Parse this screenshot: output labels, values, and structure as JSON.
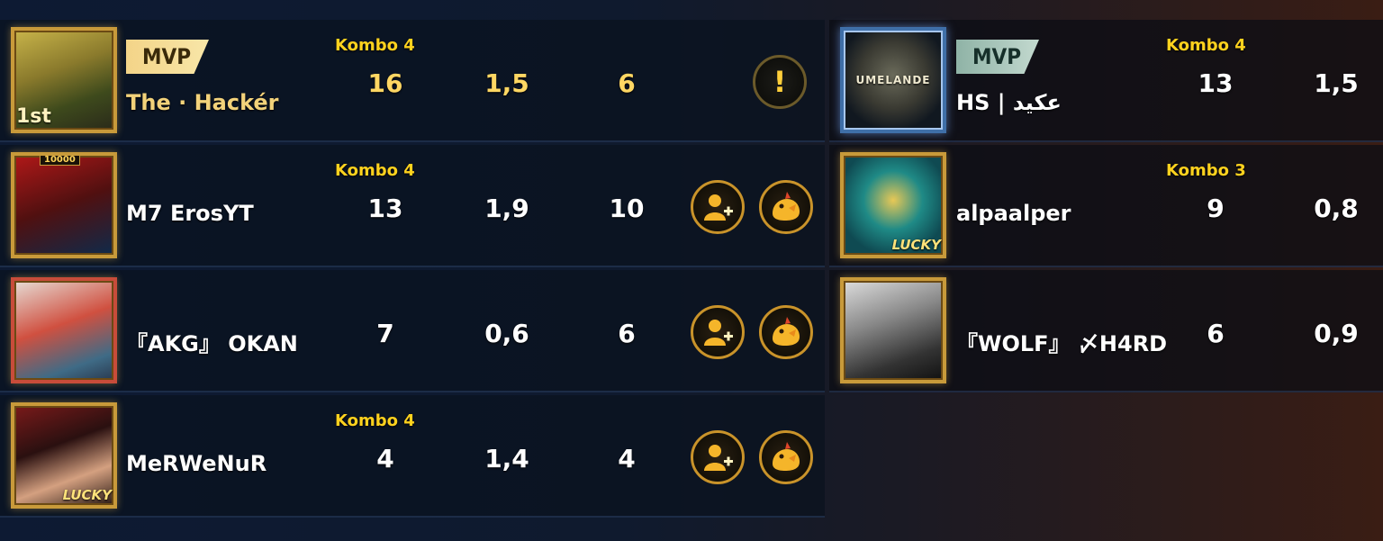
{
  "colors": {
    "accent_gold": "#ffd763",
    "kombo_yellow": "#ffd21e",
    "mvp_gold": "#f3d488",
    "mvp_teal": "#8fb3a6"
  },
  "left_team": [
    {
      "rank_badge": "1st",
      "mvp": "MVP",
      "name": "The · Hackér",
      "kombo": "Kombo 4",
      "stats": [
        "16",
        "1,5",
        "6"
      ],
      "actions": [
        "report-icon"
      ]
    },
    {
      "frame_tag": "10000",
      "name": "M7        ErosYT",
      "kombo": "Kombo 4",
      "stats": [
        "13",
        "1,9",
        "10"
      ],
      "actions": [
        "add-friend-icon",
        "like-icon"
      ]
    },
    {
      "name": "『AKG』 OKAN",
      "kombo": "",
      "stats": [
        "7",
        "0,6",
        "6"
      ],
      "actions": [
        "add-friend-icon",
        "like-icon"
      ]
    },
    {
      "frame_label": "LUCKY",
      "name": "MeRWeNuR",
      "kombo": "Kombo 4",
      "stats": [
        "4",
        "1,4",
        "4"
      ],
      "actions": [
        "add-friend-icon",
        "like-icon"
      ]
    }
  ],
  "right_team": [
    {
      "emblem_text": "UMELANDE",
      "mvp": "MVP",
      "name": "HS | عكيد",
      "kombo": "Kombo 4",
      "stats": [
        "13",
        "1,5"
      ]
    },
    {
      "frame_label": "LUCKY",
      "name": "alpaalper",
      "kombo": "Kombo 3",
      "stats": [
        "9",
        "0,8"
      ]
    },
    {
      "name": "『WOLF』 〆H4RD",
      "kombo": "",
      "stats": [
        "6",
        "0,9"
      ]
    }
  ],
  "report_symbol": "!"
}
